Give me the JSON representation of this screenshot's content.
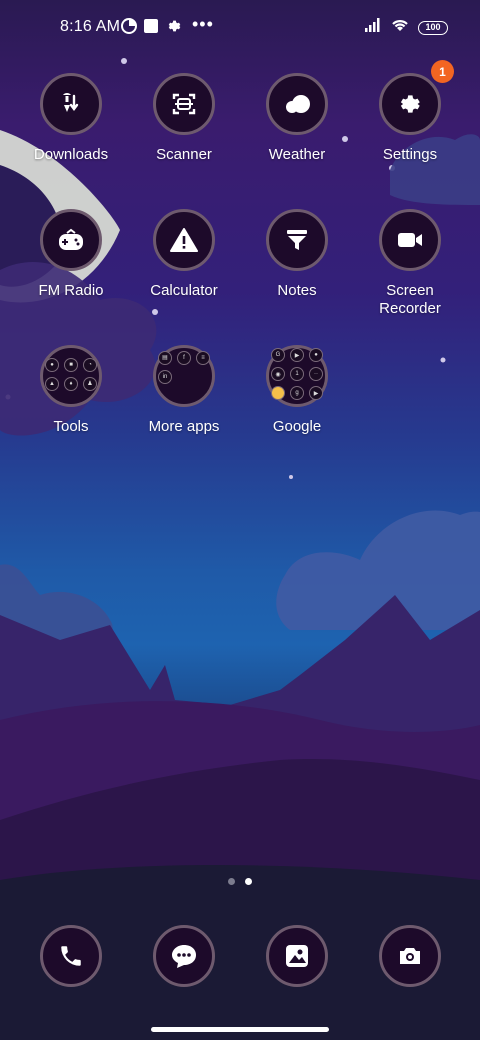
{
  "status_bar": {
    "time": "8:16 AM",
    "battery": "100",
    "icons": [
      "pie-chart-icon",
      "square-notification-icon",
      "gear-icon",
      "more-dots-icon",
      "signal-icon",
      "wifi-icon",
      "battery-icon"
    ]
  },
  "apps": [
    {
      "label": "Downloads",
      "icon": "downloads-icon"
    },
    {
      "label": "Scanner",
      "icon": "scanner-icon"
    },
    {
      "label": "Weather",
      "icon": "cloud-icon"
    },
    {
      "label": "Settings",
      "icon": "gear-icon",
      "badge": "1"
    },
    {
      "label": "FM Radio",
      "icon": "radio-icon"
    },
    {
      "label": "Calculator",
      "icon": "warning-triangle-icon"
    },
    {
      "label": "Notes",
      "icon": "funnel-icon"
    },
    {
      "label": "Screen Recorder",
      "icon": "video-camera-icon"
    },
    {
      "label": "Tools",
      "icon": "folder-icon"
    },
    {
      "label": "More apps",
      "icon": "folder-icon"
    },
    {
      "label": "Google",
      "icon": "folder-icon"
    }
  ],
  "folders": {
    "tools_minis": [
      "mic",
      "msg",
      "clock",
      "lock",
      "pin",
      "user"
    ],
    "more_apps_minis": [
      "files",
      "f",
      "menu",
      "in"
    ],
    "google_minis": [
      "G",
      "yt",
      "maps",
      "tv",
      "1",
      "dots",
      "photos",
      "g",
      "play"
    ]
  },
  "pager": {
    "pages": 2,
    "current": 2
  },
  "dock": [
    {
      "icon": "phone-icon"
    },
    {
      "icon": "messages-icon"
    },
    {
      "icon": "gallery-icon"
    },
    {
      "icon": "camera-icon"
    }
  ],
  "colors": {
    "badge": "#f26522",
    "icon_bg": "#1d0a2a",
    "icon_ring": "#6e5a6e"
  }
}
